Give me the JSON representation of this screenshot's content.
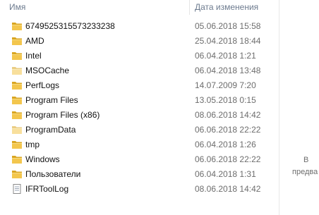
{
  "header": {
    "name_label": "Имя",
    "date_label": "Дата изменения"
  },
  "colors": {
    "folder": "#f3c64d",
    "folder_dark": "#d9a521",
    "folder_light": "#f8dc85",
    "header_text": "#6d7b8f",
    "date_text": "#6d6d6d"
  },
  "rows": [
    {
      "name": "6749525315573233238",
      "date": "05.06.2018 15:58",
      "icon": "folder-icon"
    },
    {
      "name": "AMD",
      "date": "25.04.2018 18:44",
      "icon": "folder-icon"
    },
    {
      "name": "Intel",
      "date": "06.04.2018 1:21",
      "icon": "folder-icon"
    },
    {
      "name": "MSOCache",
      "date": "06.04.2018 13:48",
      "icon": "folder-hidden-icon"
    },
    {
      "name": "PerfLogs",
      "date": "14.07.2009 7:20",
      "icon": "folder-icon"
    },
    {
      "name": "Program Files",
      "date": "13.05.2018 0:15",
      "icon": "folder-icon"
    },
    {
      "name": "Program Files (x86)",
      "date": "08.06.2018 14:42",
      "icon": "folder-icon"
    },
    {
      "name": "ProgramData",
      "date": "06.06.2018 22:22",
      "icon": "folder-hidden-icon"
    },
    {
      "name": "tmp",
      "date": "06.04.2018 1:26",
      "icon": "folder-icon"
    },
    {
      "name": "Windows",
      "date": "06.06.2018 22:22",
      "icon": "folder-icon"
    },
    {
      "name": "Пользователи",
      "date": "06.04.2018 1:31",
      "icon": "folder-icon"
    },
    {
      "name": "IFRToolLog",
      "date": "08.06.2018 14:42",
      "icon": "text-file-icon"
    }
  ],
  "preview": {
    "line1": "В",
    "line2": "предва"
  }
}
